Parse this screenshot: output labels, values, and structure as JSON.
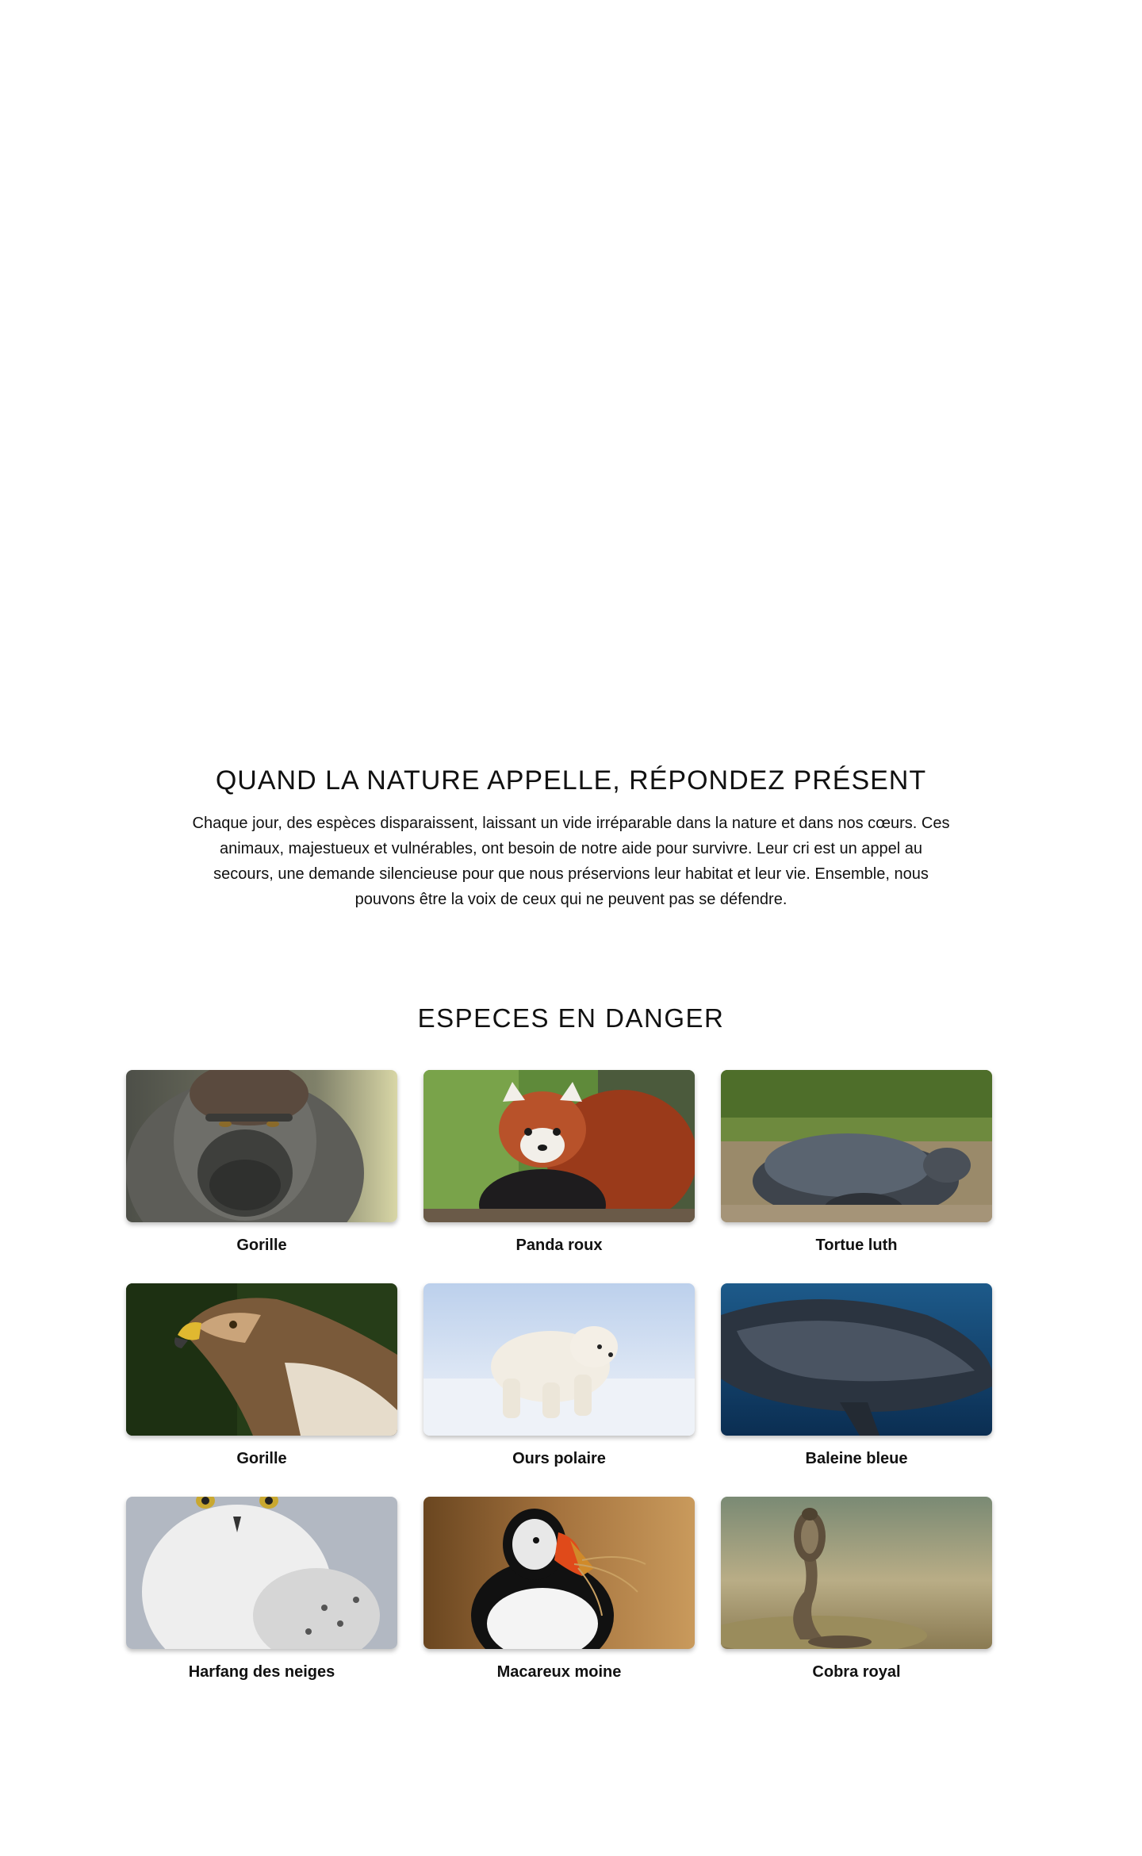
{
  "intro": {
    "title": "QUAND LA NATURE APPELLE, RÉPONDEZ PRÉSENT",
    "body": "Chaque jour, des espèces disparaissent, laissant un vide irréparable dans la nature et dans nos cœurs. Ces animaux, majestueux et vulnérables, ont besoin de notre aide pour survivre. Leur cri est un appel au secours, une demande silencieuse pour que nous préservions leur habitat et leur vie. Ensemble, nous pouvons être la voix de ceux qui ne peuvent pas se défendre."
  },
  "species": {
    "title": "ESPECES EN DANGER",
    "cards": [
      {
        "label": "Gorille",
        "image": "gorilla-photo"
      },
      {
        "label": "Panda roux",
        "image": "red-panda-photo"
      },
      {
        "label": "Tortue luth",
        "image": "leatherback-turtle-photo"
      },
      {
        "label": "Gorille",
        "image": "eagle-photo"
      },
      {
        "label": "Ours polaire",
        "image": "polar-bear-photo"
      },
      {
        "label": "Baleine bleue",
        "image": "whale-photo"
      },
      {
        "label": "Harfang des neiges",
        "image": "snowy-owl-photo"
      },
      {
        "label": "Macareux moine",
        "image": "puffin-photo"
      },
      {
        "label": "Cobra royal",
        "image": "king-cobra-photo"
      }
    ]
  }
}
